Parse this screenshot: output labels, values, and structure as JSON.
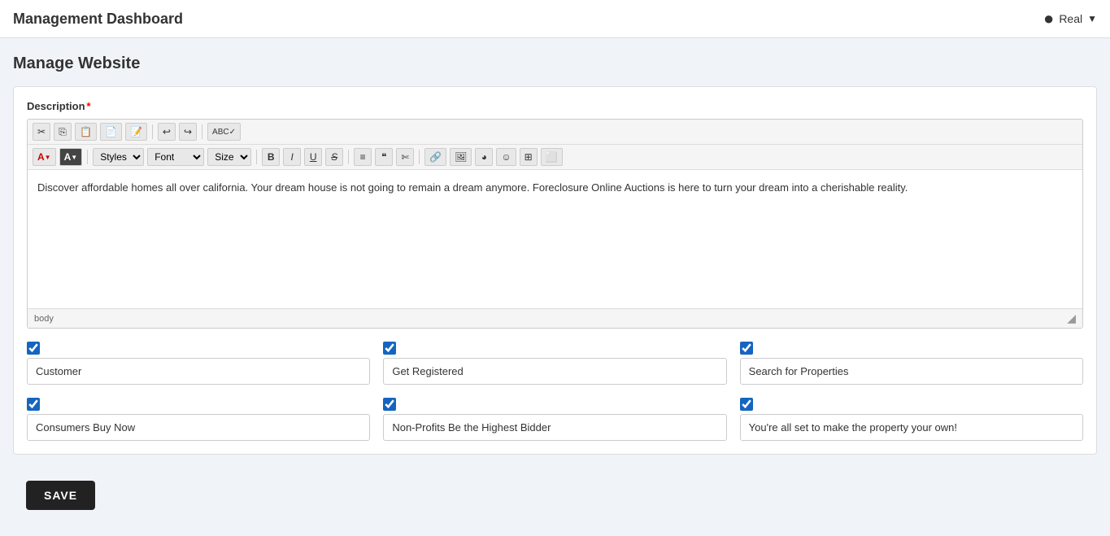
{
  "header": {
    "title": "Management Dashboard",
    "user": {
      "name": "Real",
      "avatar_symbol": "⬤"
    }
  },
  "page": {
    "subtitle": "Manage Website"
  },
  "description_field": {
    "label": "Description",
    "required": "*",
    "toolbar": {
      "cut": "✂",
      "copy": "⎘",
      "paste_text": "📋",
      "paste_word": "📄",
      "paste_plain": "📝",
      "undo": "↩",
      "redo": "↪",
      "spellcheck": "ABC",
      "styles_label": "Styles",
      "font_label": "Font",
      "size_label": "Size",
      "bold": "B",
      "italic": "I",
      "underline": "U",
      "strikethrough": "S",
      "unordered_list": "≡",
      "blockquote": "❝",
      "strike_dollar": "$",
      "link": "🔗",
      "image": "🖼",
      "media": "◉",
      "emoji": "☺",
      "table": "⊞",
      "iframe": "⬚"
    },
    "content": "Discover affordable homes all over california. Your dream house is not going to remain a dream anymore. Foreclosure Online Auctions is here to turn your dream into a cherishable reality.",
    "footer_tag": "body"
  },
  "checkboxes": {
    "items": [
      {
        "id": "cb1",
        "checked": true,
        "label": "Customer"
      },
      {
        "id": "cb2",
        "checked": true,
        "label": "Get Registered"
      },
      {
        "id": "cb3",
        "checked": true,
        "label": "Search for Properties"
      },
      {
        "id": "cb4",
        "checked": true,
        "label": "Consumers Buy Now"
      },
      {
        "id": "cb5",
        "checked": true,
        "label": "Non-Profits Be the Highest Bidder"
      },
      {
        "id": "cb6",
        "checked": true,
        "label": "You're all set to make the property your own!"
      }
    ]
  },
  "save_button": {
    "label": "SAVE"
  }
}
